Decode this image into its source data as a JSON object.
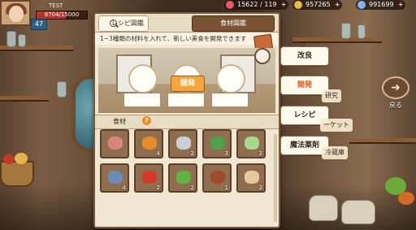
{
  "hud": {
    "player_name": "TEST",
    "level": "47",
    "exp_text": "8704/15000",
    "exp_fraction": 0.58,
    "resources": [
      {
        "icon": "stamina-heart-icon",
        "value": "15622 / 119",
        "color": "#e6596a"
      },
      {
        "icon": "gold-coin-icon",
        "value": "957265",
        "color": "#e9b94a"
      },
      {
        "icon": "gem-icon",
        "value": "991699",
        "color": "#7bb5f0"
      }
    ]
  },
  "panel": {
    "tab_recipe_book": "レシピ図鑑",
    "tab_ingredient_book": "食材図鑑",
    "instruction": "1~3種類の材料を入れて、新しい美食を開発できます",
    "develop_button": "開発",
    "ingredients_label": "食材",
    "help_symbol": "?",
    "ingredients": [
      {
        "icon": "fish-steak-icon",
        "count": "",
        "color": "#d9847c"
      },
      {
        "icon": "carrot-bundle-icon",
        "count": "4",
        "color": "#e5892b"
      },
      {
        "icon": "knife-fish-icon",
        "count": "2",
        "color": "#c9cdd6"
      },
      {
        "icon": "green-herb-icon",
        "count": "3",
        "color": "#4aa24d"
      },
      {
        "icon": "cabbage-icon",
        "count": "2",
        "color": "#a8d88b"
      },
      {
        "icon": "blue-fish-icon",
        "count": "4",
        "color": "#6b8bb5"
      },
      {
        "icon": "red-meat-icon",
        "count": "2",
        "color": "#d33a2a"
      },
      {
        "icon": "green-pepper-icon",
        "count": "2",
        "color": "#5db640"
      },
      {
        "icon": "sausage-icon",
        "count": "1",
        "color": "#a04a2e"
      },
      {
        "icon": "mushroom-icon",
        "count": "2",
        "color": "#e8c89a"
      }
    ]
  },
  "side_menu": {
    "improve": "改良",
    "develop": "開発",
    "recipe": "レシピ",
    "magic_seasoning": "魔法薬剤",
    "tag_research": "研究",
    "tag_market": "ーケット",
    "tag_fridge": "冷蔵庫",
    "back": "戻る"
  }
}
